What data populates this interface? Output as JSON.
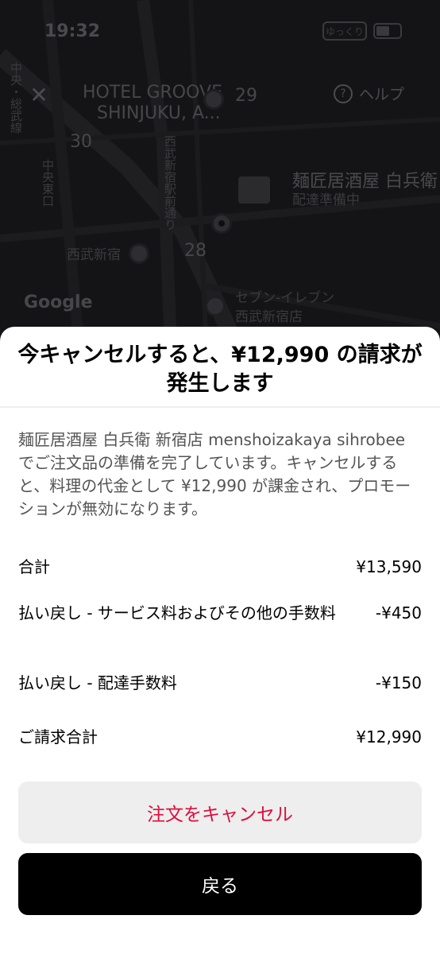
{
  "status_bar": {
    "time": "19:32",
    "carrier": "ゆっくり"
  },
  "map": {
    "close_icon": "close-icon",
    "help_label": "ヘルプ",
    "labels": {
      "hotel_line1": "HOTEL GROOVE",
      "hotel_line2": "SHINJUKU, A...",
      "block_29": "29",
      "block_30": "30",
      "block_28": "28",
      "store_name": "麺匠居酒屋 白兵衛",
      "store_status": "配達準備中",
      "station": "西武新宿",
      "seven_line1": "セブン-イレブン",
      "seven_line2": "西武新宿店",
      "street_vertical": "西武新宿駅前通り",
      "street_left": "中央東口",
      "street_topleft": "中央・総武線",
      "google": "Google"
    }
  },
  "sheet": {
    "title": "今キャンセルすると、¥12,990 の請求が発生します",
    "description": "麺匠居酒屋 白兵衛 新宿店 menshoizakaya sihrobee でご注文品の準備を完了しています。キャンセルすると、料理の代金として ¥12,990 が課金され、プロモーションが無効になります。",
    "rows": [
      {
        "label": "合計",
        "amount": "¥13,590"
      },
      {
        "label": "払い戻し - サービス料およびその他の手数料",
        "amount": "-¥450"
      },
      {
        "label": "払い戻し - 配達手数料",
        "amount": "-¥150"
      },
      {
        "label": "ご請求合計",
        "amount": "¥12,990"
      }
    ],
    "cancel_button": "注文をキャンセル",
    "back_button": "戻る"
  },
  "colors": {
    "cancel_text": "#dd0e3d",
    "cancel_bg": "#eeeeee",
    "back_bg": "#000000",
    "back_text": "#ffffff",
    "overlay": "#141416"
  }
}
